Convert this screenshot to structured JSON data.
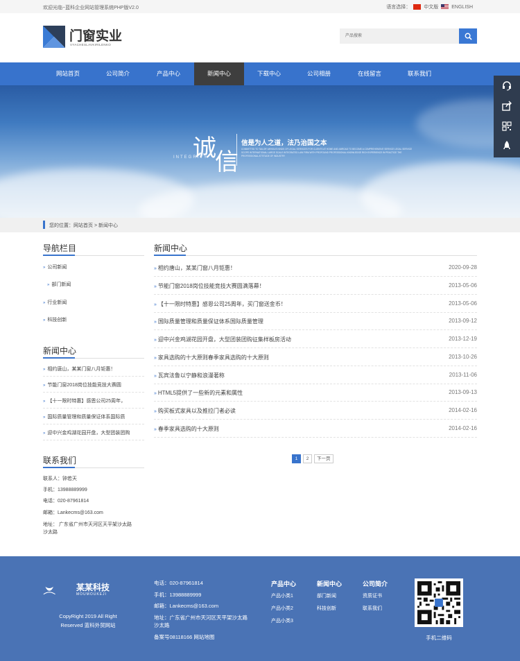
{
  "topbar": {
    "welcome": "欢迎光临~蓝科企业网站管理系统PHP版V2.0",
    "lang_label": "语言选择：",
    "lang_cn": "中文版",
    "lang_en": "ENGLISH"
  },
  "brand": {
    "title": "门窗实业",
    "subtitle": "VYACHESLAVKIRILENKO"
  },
  "search": {
    "placeholder": "产品搜索"
  },
  "nav": {
    "items": [
      "网站首页",
      "公司简介",
      "产品中心",
      "新闻中心",
      "下载中心",
      "公司相册",
      "在线留言",
      "联系我们"
    ],
    "active": "新闻中心"
  },
  "banner": {
    "char1": "诚",
    "char2": "信",
    "integrity": "INTEGRITY",
    "slogan": "信是为人之道，法乃治国之本",
    "english": "COMMITTED TO TAILOR VARIOUS KINDS OF LEGAL SERVICES FOR CLIENTS AT HOME AND ABROAD TO BECOME A COMPREHENSIVE SERVICE LEGAL SERVICE SCOPE INTERNATIONAL LARGE SCALE INTEGRATED LAW FIRM WITH PROFOUND PROFESSIONAL KNOWLEDGE RICH EXPERIENCE IN PRACTICE THE PROFESSIONAL ATTITUDE OF INDUSTRY"
  },
  "breadcrumb": "您的位置：网站首页 > 新闻中心",
  "sidebar": {
    "nav_title": "导航栏目",
    "nav_items": [
      "公司新闻",
      "部门新闻",
      "行业新闻",
      "科技创新"
    ],
    "news_title": "新闻中心",
    "news_items": [
      "相约唐山，某某门窗八月钜惠！",
      "节能门窗2018岗位技能竞技大赛圆",
      "【十一限时特惠】感恩公司25周年，",
      "国际质量管理和质量保证体系国际质",
      "迎中兴金鸡湖花园开盘，大型团装团购"
    ],
    "contact_title": "联系我们",
    "contact": {
      "person": "联系人：钟若天",
      "mobile": "手机：13988889999",
      "phone": "电话：020-87961814",
      "email": "邮箱：Lankecms@163.com",
      "address1": "地址： 广东省广州市天河区天平架沙太路",
      "address2": "沙太路"
    }
  },
  "main": {
    "title": "新闻中心",
    "news": [
      {
        "title": "相约唐山，某某门窗八月钜惠！",
        "date": "2020-09-28"
      },
      {
        "title": "节能门窗2018岗位技能竞技大赛圆满落幕！",
        "date": "2013-05-06"
      },
      {
        "title": "【十一限时特惠】感恩公司25周年，买门窗送金币！",
        "date": "2013-05-06"
      },
      {
        "title": "国际质量管理和质量保证体系国际质量管理",
        "date": "2013-09-12"
      },
      {
        "title": "迎中兴金鸡湖花园开盘，大型团装团购征集样板房活动",
        "date": "2013-12-19"
      },
      {
        "title": "家具选购的十大原则春季家具选购的十大原则",
        "date": "2013-10-26"
      },
      {
        "title": "瓦宾法鲁以宁静和浪漫著称",
        "date": "2013-11-06"
      },
      {
        "title": "HTML5提供了一些新的元素和属性",
        "date": "2013-09-13"
      },
      {
        "title": "购买板式家具以及推拉门者必读",
        "date": "2014-02-16"
      },
      {
        "title": "春季家具选购的十大原则",
        "date": "2014-02-16"
      }
    ],
    "pager": {
      "page1": "1",
      "page2": "2",
      "next": "下一页"
    }
  },
  "footer": {
    "brand": "某某科技",
    "brand_en": "MOUMOUKEJI",
    "copyright1": "CopyRight 2019 All Right",
    "copyright2": "Reserved 蓝科外贸网站",
    "phone": "电话：020-87961814",
    "mobile": "手机：13988889999",
    "email": "邮箱：Lankecms@163.com",
    "address1": "地址：广东省广州市天河区天平架沙太路",
    "address2": "沙太路",
    "icp": "备案号08118166   网站地图",
    "col1": {
      "title": "产品中心",
      "items": [
        "产品小类1",
        "产品小类2",
        "产品小类3"
      ]
    },
    "col2": {
      "title": "新闻中心",
      "items": [
        "部门新闻",
        "科技创新"
      ]
    },
    "col3": {
      "title": "公司简介",
      "items": [
        "资质证书",
        "联系我们"
      ]
    },
    "qr_label": "手机二维码"
  },
  "colors": {
    "primary": "#3873cc",
    "nav_active": "#3e3e3e",
    "footer": "#4a73b5"
  }
}
